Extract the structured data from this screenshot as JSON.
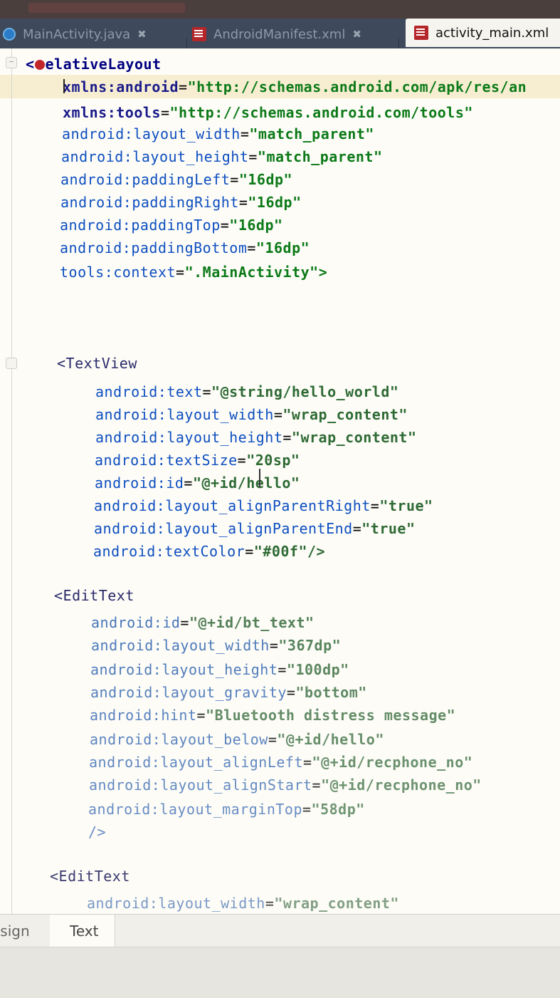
{
  "tabs": [
    {
      "label": "MainActivity.java",
      "icon": "java-file-icon",
      "active": false
    },
    {
      "label": "AndroidManifest.xml",
      "icon": "xml-file-icon",
      "active": false
    },
    {
      "label": "activity_main.xml",
      "icon": "xml-file-icon",
      "active": true
    }
  ],
  "editor": {
    "root_tag": "elativeLayout",
    "lines": [
      {
        "attr": "xmlns:android",
        "val": "\"http://schemas.android.com/apk/res/an"
      },
      {
        "attr": "xmlns:tools",
        "val": "\"http://schemas.android.com/tools\""
      },
      {
        "attr": "android:layout_width",
        "val": "\"match_parent\""
      },
      {
        "attr": "android:layout_height",
        "val": "\"match_parent\""
      },
      {
        "attr": "android:paddingLeft",
        "val": "\"16dp\""
      },
      {
        "attr": "android:paddingRight",
        "val": "\"16dp\""
      },
      {
        "attr": "android:paddingTop",
        "val": "\"16dp\""
      },
      {
        "attr": "android:paddingBottom",
        "val": "\"16dp\""
      },
      {
        "attr": "tools:context",
        "val": "\".MainActivity\">"
      }
    ],
    "textview": {
      "tag": "<TextView",
      "attrs": [
        {
          "attr": "android:text",
          "val": "\"@string/hello_world\""
        },
        {
          "attr": "android:layout_width",
          "val": "\"wrap_content\""
        },
        {
          "attr": "android:layout_height",
          "val": "\"wrap_content\""
        },
        {
          "attr": "android:textSize",
          "val": "\"20sp\""
        },
        {
          "attr": "android:id",
          "val": "\"@+id/hello\""
        },
        {
          "attr": "android:layout_alignParentRight",
          "val": "\"true\""
        },
        {
          "attr": "android:layout_alignParentEnd",
          "val": "\"true\""
        },
        {
          "attr": "android:textColor",
          "val": "\"#00f\"/>"
        }
      ]
    },
    "edittext1": {
      "tag": "<EditText",
      "attrs": [
        {
          "attr": "android:id",
          "val": "\"@+id/bt_text\""
        },
        {
          "attr": "android:layout_width",
          "val": "\"367dp\""
        },
        {
          "attr": "android:layout_height",
          "val": "\"100dp\""
        },
        {
          "attr": "android:layout_gravity",
          "val": "\"bottom\""
        },
        {
          "attr": "android:hint",
          "val": "\"Bluetooth distress message\""
        },
        {
          "attr": "android:layout_below",
          "val": "\"@+id/hello\""
        },
        {
          "attr": "android:layout_alignLeft",
          "val": "\"@+id/recphone_no\""
        },
        {
          "attr": "android:layout_alignStart",
          "val": "\"@+id/recphone_no\""
        },
        {
          "attr": "android:layout_marginTop",
          "val": "\"58dp\""
        }
      ],
      "close": "/>"
    },
    "edittext2": {
      "tag": "<EditText",
      "attrs": [
        {
          "attr": "android:layout_width",
          "val": "\"wrap_content\""
        }
      ]
    }
  },
  "bottom_tabs": [
    {
      "label": "esign"
    },
    {
      "label": "Text"
    }
  ]
}
